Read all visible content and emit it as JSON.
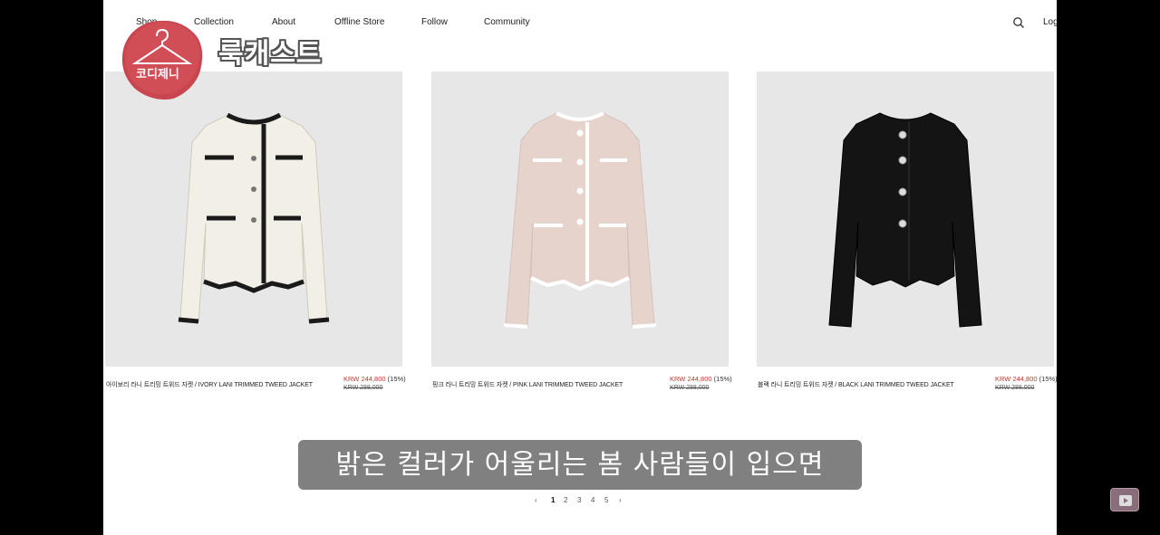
{
  "nav": {
    "items": [
      "Shop",
      "Collection",
      "About",
      "Offline Store",
      "Follow",
      "Community"
    ],
    "login": "Log"
  },
  "overlay": {
    "logo_text": "코디제니",
    "title": "룩캐스트",
    "subtitle": "밝은 컬러가 어울리는 봄 사람들이 입으면"
  },
  "products": [
    {
      "name": "아이보리 라니 트리밍 트위드 자켓 / IVORY LANI TRIMMED TWEED JACKET",
      "price": "KRW 244,800",
      "discount": "(15%)",
      "original_price": "KRW 288,000",
      "body_color": "#f2efe6",
      "trim_color": "#1a1a1a"
    },
    {
      "name": "핑크 라니 트리밍 트위드 자켓 / PINK LANI TRIMMED TWEED JACKET",
      "price": "KRW 244,800",
      "discount": "(15%)",
      "original_price": "KRW 288,000",
      "body_color": "#e6d3cc",
      "trim_color": "#ffffff"
    },
    {
      "name": "블랙 라니 트리밍 트위드 자켓 / BLACK LANI TRIMMED TWEED JACKET",
      "price": "KRW 244,800",
      "discount": "(15%)",
      "original_price": "KRW 288,000",
      "body_color": "#141414",
      "trim_color": "#141414"
    }
  ],
  "pagination": {
    "prev": "‹",
    "pages": [
      "1",
      "2",
      "3",
      "4",
      "5"
    ],
    "current": "1",
    "next": "›"
  },
  "colors": {
    "sale_price": "#c0392b",
    "badge_red": "#c9454f",
    "page_bg": "#ffffff",
    "image_bg": "#e7e7e7"
  },
  "icons": {
    "search": "search-icon",
    "hanger": "hanger-icon",
    "play": "play-icon"
  }
}
